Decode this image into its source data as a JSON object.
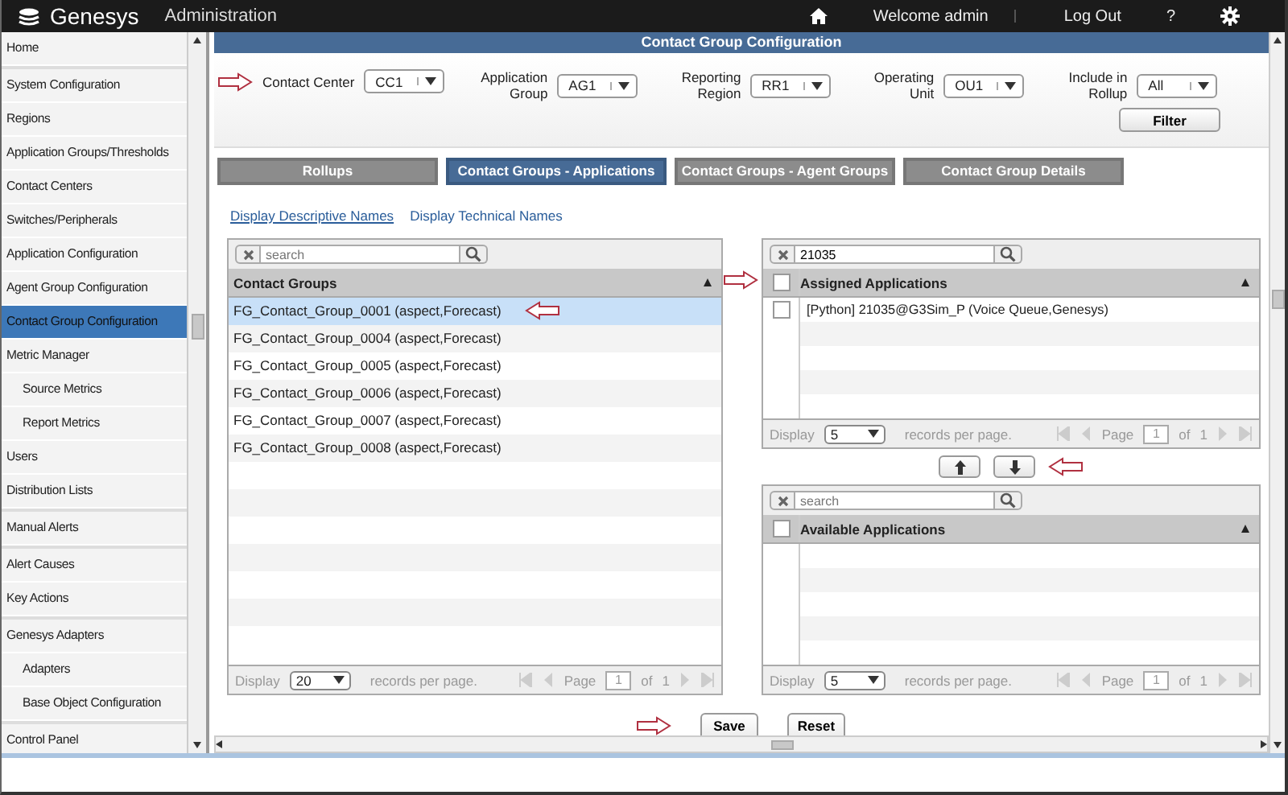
{
  "header": {
    "logo": "Genesys",
    "app": "Administration",
    "welcome": "Welcome  admin",
    "logout": "Log Out",
    "help": "?"
  },
  "sidebar": {
    "groups": [
      {
        "items": [
          {
            "label": "Home",
            "selected": false
          }
        ]
      },
      {
        "items": [
          {
            "label": "System Configuration",
            "selected": false
          },
          {
            "label": "Regions",
            "selected": false
          },
          {
            "label": "Application Groups/Thresholds",
            "selected": false
          },
          {
            "label": "Contact Centers",
            "selected": false
          },
          {
            "label": "Switches/Peripherals",
            "selected": false
          },
          {
            "label": "Application Configuration",
            "selected": false
          },
          {
            "label": "Agent Group Configuration",
            "selected": false
          },
          {
            "label": "Contact Group Configuration",
            "selected": true
          },
          {
            "label": "Metric Manager",
            "selected": false,
            "children": [
              {
                "label": "Source Metrics",
                "selected": false
              },
              {
                "label": "Report Metrics",
                "selected": false
              }
            ]
          },
          {
            "label": "Users",
            "selected": false
          },
          {
            "label": "Distribution Lists",
            "selected": false
          }
        ]
      },
      {
        "items": [
          {
            "label": "Manual Alerts",
            "selected": false
          }
        ]
      },
      {
        "items": [
          {
            "label": "Alert Causes",
            "selected": false
          },
          {
            "label": "Key Actions",
            "selected": false
          }
        ]
      },
      {
        "items": [
          {
            "label": "Genesys Adapters",
            "selected": false,
            "children": [
              {
                "label": "Adapters",
                "selected": false
              },
              {
                "label": "Base Object Configuration",
                "selected": false
              }
            ]
          }
        ]
      },
      {
        "items": [
          {
            "label": "Control Panel",
            "selected": false
          }
        ]
      }
    ]
  },
  "page_title": "Contact Group Configuration",
  "filters": [
    {
      "label": "Contact Center",
      "value": "CC1"
    },
    {
      "label": "Application Group",
      "value": "AG1"
    },
    {
      "label": "Reporting Region",
      "value": "RR1"
    },
    {
      "label": "Operating Unit",
      "value": "OU1"
    },
    {
      "label": "Include in Rollup",
      "value": "All"
    }
  ],
  "filter_button": "Filter",
  "tabs": [
    {
      "label": "Rollups",
      "selected": false
    },
    {
      "label": "Contact Groups - Applications",
      "selected": true
    },
    {
      "label": "Contact Groups - Agent Groups",
      "selected": false
    },
    {
      "label": "Contact Group Details",
      "selected": false
    }
  ],
  "name_links": [
    {
      "label": "Display Descriptive Names",
      "selected": true
    },
    {
      "label": "Display Technical Names",
      "selected": false
    }
  ],
  "contact_groups": {
    "search": {
      "placeholder": "search"
    },
    "header": "Contact Groups",
    "rows": [
      {
        "label": "FG_Contact_Group_0001 (aspect,Forecast)",
        "selected": true
      },
      {
        "label": "FG_Contact_Group_0004 (aspect,Forecast)",
        "selected": false
      },
      {
        "label": "FG_Contact_Group_0005 (aspect,Forecast)",
        "selected": false
      },
      {
        "label": "FG_Contact_Group_0006 (aspect,Forecast)",
        "selected": false
      },
      {
        "label": "FG_Contact_Group_0007 (aspect,Forecast)",
        "selected": false
      },
      {
        "label": "FG_Contact_Group_0008 (aspect,Forecast)",
        "selected": false
      }
    ],
    "pager": {
      "display": "Display",
      "per_page": "20",
      "records": "records per page.",
      "page": "Page",
      "page_value": "1",
      "of": "of",
      "total": "1"
    }
  },
  "assigned": {
    "search": {
      "value": "21035"
    },
    "header": "Assigned Applications",
    "header_checked": false,
    "rows": [
      {
        "label": "[Python] 21035@G3Sim_P (Voice Queue,Genesys)",
        "checked": false
      }
    ],
    "pager": {
      "display": "Display",
      "per_page": "5",
      "records": "records per page.",
      "page": "Page",
      "page_value": "1",
      "of": "of",
      "total": "1"
    }
  },
  "available": {
    "search": {
      "placeholder": "search"
    },
    "header": "Available Applications",
    "header_checked": false,
    "pager": {
      "display": "Display",
      "per_page": "5",
      "records": "records per page.",
      "page": "Page",
      "page_value": "1",
      "of": "of",
      "total": "1"
    }
  },
  "buttons": [
    "Save",
    "Reset"
  ]
}
